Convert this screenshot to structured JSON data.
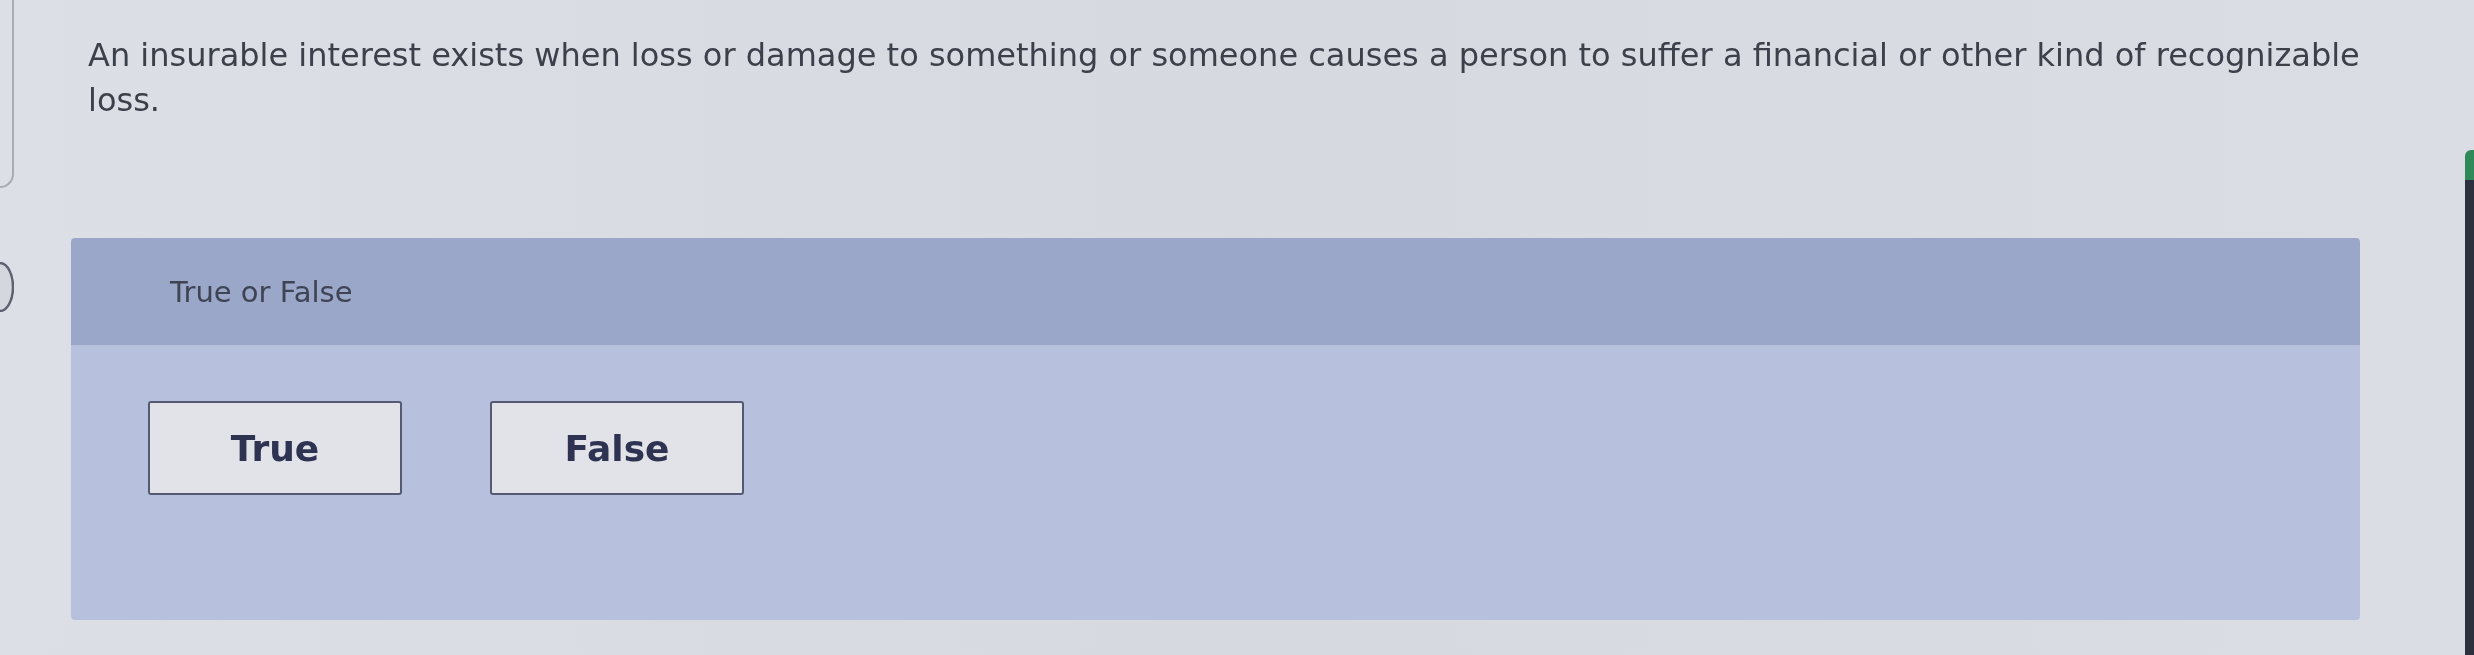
{
  "question": {
    "text": "An insurable interest exists when loss or damage to something or someone causes a person to suffer a financial or other kind of recognizable loss."
  },
  "answer_panel": {
    "title": "True or False",
    "options": [
      {
        "label": "True",
        "selected": false
      },
      {
        "label": "False",
        "selected": false
      }
    ]
  }
}
